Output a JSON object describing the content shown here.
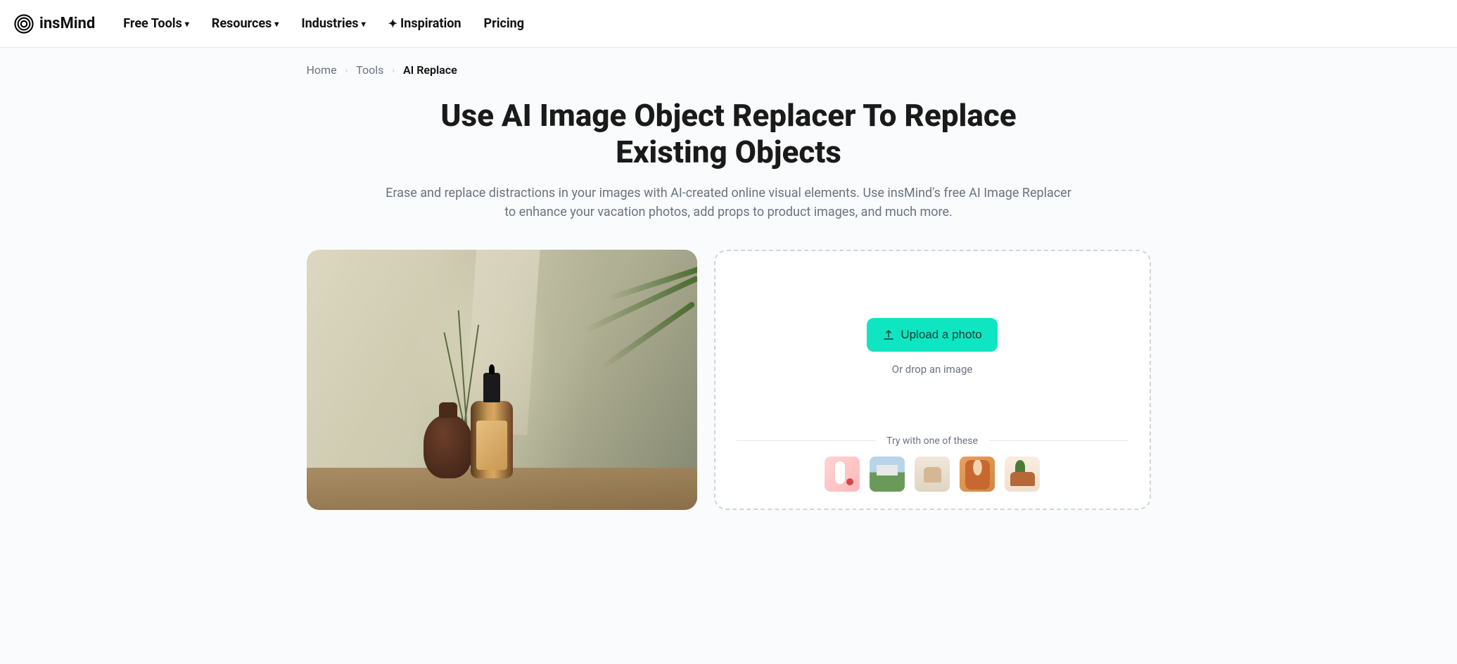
{
  "brand": "insMind",
  "nav": {
    "free_tools": "Free Tools",
    "resources": "Resources",
    "industries": "Industries",
    "inspiration": "Inspiration",
    "pricing": "Pricing"
  },
  "breadcrumb": {
    "home": "Home",
    "tools": "Tools",
    "current": "AI Replace"
  },
  "hero": {
    "title": "Use AI Image Object Replacer To Replace Existing Objects",
    "subtitle": "Erase and replace distractions in your images with AI-created online visual elements. Use insMind's free AI Image Replacer to enhance your vacation photos, add props to product images, and much more."
  },
  "upload": {
    "button": "Upload a photo",
    "drop": "Or drop an image",
    "try_label": "Try with one of these"
  },
  "samples": [
    {
      "name": "sample-cosmetic"
    },
    {
      "name": "sample-house"
    },
    {
      "name": "sample-handbag"
    },
    {
      "name": "sample-portrait"
    },
    {
      "name": "sample-interior"
    }
  ]
}
